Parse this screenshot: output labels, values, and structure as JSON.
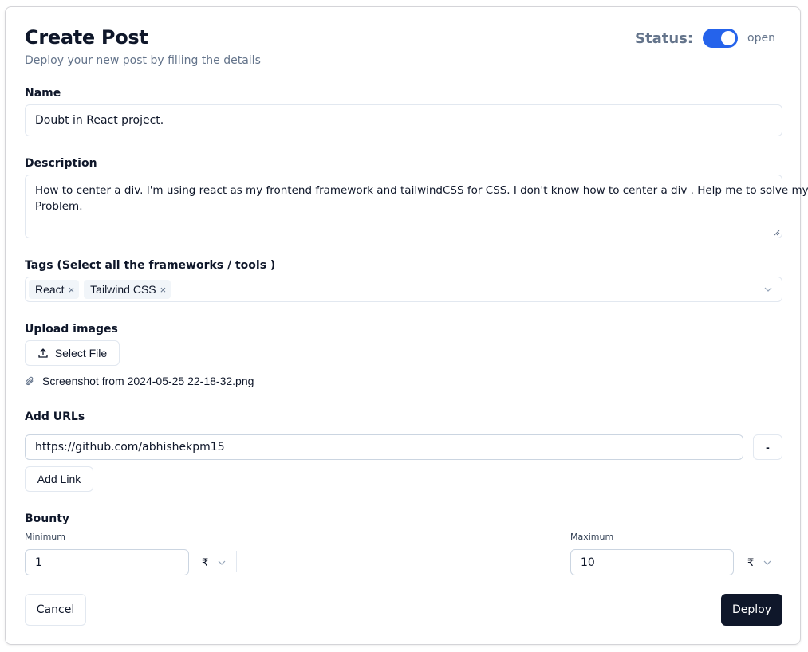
{
  "header": {
    "title": "Create Post",
    "subtitle": "Deploy your new post by filling the details",
    "status_label": "Status:",
    "status_value": "open",
    "status_on": true
  },
  "name": {
    "label": "Name",
    "value": "Doubt in React project."
  },
  "description": {
    "label": "Description",
    "line1": "How to center a div. I'm using react as my frontend framework and tailwindCSS for CSS. I don't know how to center a div . Help me to solve my",
    "line2": "Problem."
  },
  "tags": {
    "label": "Tags  (Select all the frameworks / tools )",
    "selected": [
      "React",
      "Tailwind CSS"
    ],
    "remove_glyph": "×"
  },
  "upload": {
    "label": "Upload images",
    "button_label": "Select File",
    "file_name": "Screenshot from 2024-05-25 22-18-32.png"
  },
  "urls": {
    "label": "Add URLs",
    "items": [
      "https://github.com/abhishekpm15"
    ],
    "remove_label": "-",
    "add_label": "Add Link"
  },
  "bounty": {
    "label": "Bounty",
    "min_label": "Minimum",
    "min_value": "1",
    "max_label": "Maximum",
    "max_value": "10",
    "currency": "₹"
  },
  "footer": {
    "cancel_label": "Cancel",
    "deploy_label": "Deploy"
  },
  "colors": {
    "accent": "#2563eb",
    "primary_dark": "#0f172a",
    "muted": "#64748b",
    "border": "#e2e8f0"
  },
  "icons": [
    "upload-icon",
    "paperclip-icon",
    "chevron-down-icon",
    "close-icon",
    "resize-handle-icon"
  ]
}
